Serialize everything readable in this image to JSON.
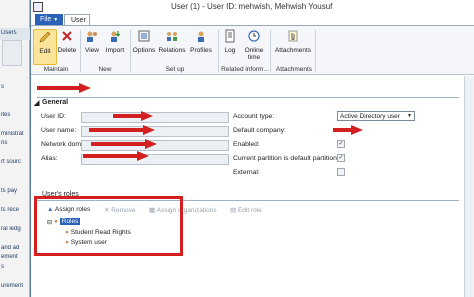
{
  "window": {
    "title": "User (1) - User ID: mehwish, Mehwish Yousuf"
  },
  "background_window": {
    "nav_label": "Users",
    "items": [
      "s",
      "ites",
      "ministrat",
      "ns",
      "rt sourc",
      "ts pay",
      "ts rece",
      "ral ledg",
      "and ad",
      "ement",
      "s",
      "urement"
    ]
  },
  "tabs": {
    "file": "File",
    "user": "User"
  },
  "ribbon": {
    "buttons": {
      "edit": "Edit",
      "delete": "Delete",
      "view": "View",
      "import": "Import",
      "options": "Options",
      "relations": "Relations",
      "profiles": "Profiles",
      "log": "Log",
      "online_time_1": "Online",
      "online_time_2": "time",
      "attachments": "Attachments"
    },
    "groups": {
      "maintain": "Maintain",
      "new": "New",
      "setup": "Set up",
      "related": "Related inform...",
      "attachments": "Attachments"
    }
  },
  "general": {
    "section_title": "General",
    "labels": {
      "user_id": "User ID:",
      "user_name": "User name:",
      "network_domain": "Network dom",
      "alias": "Alias:",
      "account_type": "Account type:",
      "default_company": "Default company:",
      "enabled": "Enabled:",
      "partition_default": "Current partition is default partition:",
      "external": "External:"
    },
    "values": {
      "account_type": "Active Directory user",
      "enabled": "✓",
      "partition_default": "✓"
    }
  },
  "roles": {
    "section_title": "User's roles",
    "toolbar": {
      "assign": "Assign roles",
      "remove": "Remove",
      "assign_orgs": "Assign organizations",
      "edit": "Edit role"
    },
    "tree": {
      "root": "Roles",
      "children": [
        "Student Read Rights",
        "System user"
      ]
    }
  },
  "colors": {
    "annotation_red": "#d21f1f",
    "file_tab": "#2a62b8"
  }
}
